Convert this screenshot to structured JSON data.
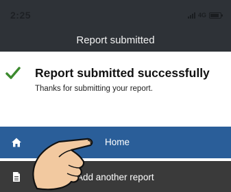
{
  "status_bar": {
    "time": "2:25",
    "network": "4G"
  },
  "header": {
    "title": "Report submitted"
  },
  "message": {
    "heading": "Report submitted successfully",
    "subtext": "Thanks for submitting your report."
  },
  "actions": {
    "home_label": "Home",
    "add_report_label": "Add another report"
  },
  "icons": {
    "success": "checkmark-icon",
    "home": "home-icon",
    "add": "document-icon",
    "pointer": "pointing-hand-icon"
  },
  "colors": {
    "header_bg": "#2e3237",
    "primary_button": "#2a5e99",
    "secondary_button": "#3a3a3a",
    "success_green": "#3c8a2e"
  }
}
